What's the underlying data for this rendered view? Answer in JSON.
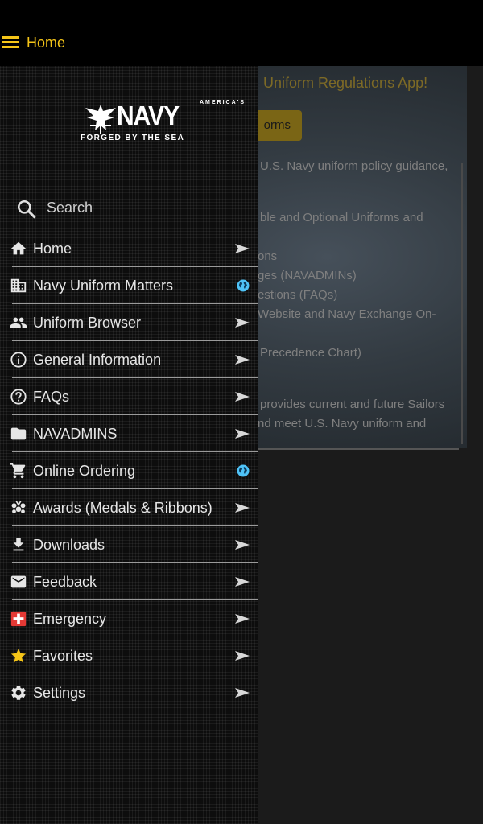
{
  "topbar": {
    "title": "Home",
    "accent": "#f5c518"
  },
  "background": {
    "title_fragment": "Uniform Regulations App!",
    "button_fragment": "orms",
    "lines": [
      "U.S. Navy uniform policy guidance,",
      "ble and Optional Uniforms and",
      "ons",
      "ges (NAVADMINs)",
      "estions (FAQs)",
      "Website and Navy Exchange On-",
      "Precedence Chart)",
      "provides current and future Sailors",
      "nd meet U.S. Navy uniform and"
    ]
  },
  "drawer": {
    "logo": {
      "small": "AMERICA'S",
      "main": "NAVY",
      "tagline": "FORGED BY THE SEA"
    },
    "search": {
      "label": "Search",
      "icon": "search-icon"
    },
    "items": [
      {
        "label": "Home",
        "icon": "home-icon",
        "trailing": "arrow"
      },
      {
        "label": "Navy Uniform Matters",
        "icon": "building-icon",
        "trailing": "globe"
      },
      {
        "label": "Uniform Browser",
        "icon": "people-icon",
        "trailing": "arrow"
      },
      {
        "label": "General Information",
        "icon": "info-icon",
        "trailing": "arrow"
      },
      {
        "label": "FAQs",
        "icon": "help-icon",
        "trailing": "arrow"
      },
      {
        "label": "NAVADMINS",
        "icon": "folder-icon",
        "trailing": "arrow"
      },
      {
        "label": "Online Ordering",
        "icon": "cart-icon",
        "trailing": "globe"
      },
      {
        "label": "Awards (Medals & Ribbons)",
        "icon": "medals-icon",
        "trailing": "arrow"
      },
      {
        "label": "Downloads",
        "icon": "download-icon",
        "trailing": "arrow"
      },
      {
        "label": "Feedback",
        "icon": "mail-icon",
        "trailing": "arrow"
      },
      {
        "label": "Emergency",
        "icon": "medical-cross-icon",
        "trailing": "arrow"
      },
      {
        "label": "Favorites",
        "icon": "star-icon",
        "trailing": "arrow"
      },
      {
        "label": "Settings",
        "icon": "gear-icon",
        "trailing": "arrow"
      }
    ]
  }
}
